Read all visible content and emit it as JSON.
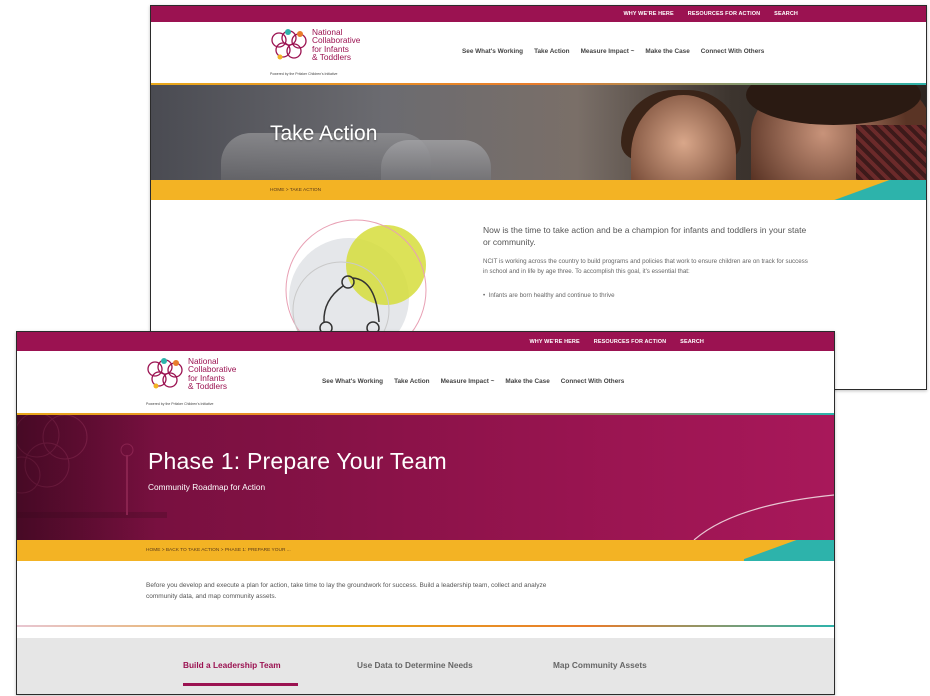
{
  "site": {
    "logo_lines": [
      "National",
      "Collaborative",
      "for Infants",
      "& Toddlers"
    ],
    "logo_tagline": "Powered by the Pritzker Children's Initiative",
    "utility_links": [
      "WHY WE'RE HERE",
      "RESOURCES FOR ACTION",
      "SEARCH"
    ],
    "nav": [
      "See What's Working",
      "Take Action",
      "Measure Impact ~",
      "Make the Case",
      "Connect With Others"
    ],
    "colors": {
      "brand": "#9b1251",
      "gold": "#f3b324",
      "teal": "#2db3ab"
    }
  },
  "back_page": {
    "hero_title": "Take Action",
    "breadcrumb": "HOME  >  TAKE ACTION",
    "lead": "Now is the time to take action and be a champion for infants and toddlers in your state or community.",
    "body": "NCIT is working across the country to build programs and policies that work to ensure children are on track for success in school and in life by age three. To accomplish this goal, it's essential that:",
    "bullet": "Infants are born healthy and continue to thrive"
  },
  "front_page": {
    "hero_title": "Phase 1: Prepare Your Team",
    "hero_subtitle": "Community Roadmap for Action",
    "breadcrumb": "HOME  >  BACK TO TAKE ACTION  >  PHASE 1: PREPARE YOUR ...",
    "intro": "Before you develop and execute a plan for action, take time to lay the groundwork for success. Build a leadership team, collect and analyze community data, and map community assets.",
    "tabs": [
      {
        "label": "Build a Leadership Team",
        "active": true
      },
      {
        "label": "Use Data to Determine Needs",
        "active": false
      },
      {
        "label": "Map Community Assets",
        "active": false
      }
    ]
  }
}
